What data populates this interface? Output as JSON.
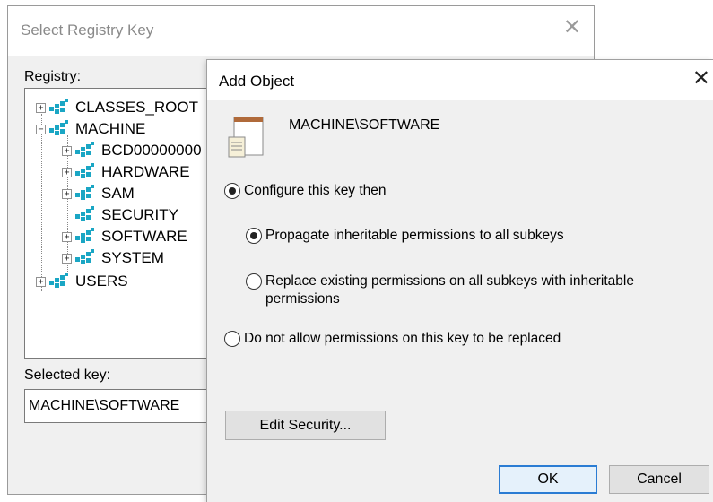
{
  "background_dialog": {
    "title": "Select Registry Key",
    "close_glyph": "✕",
    "registry_label": "Registry:",
    "tree": [
      {
        "label": "CLASSES_ROOT",
        "expander": "+"
      },
      {
        "label": "MACHINE",
        "expander": "−"
      },
      {
        "label": "BCD00000000",
        "expander": "+"
      },
      {
        "label": "HARDWARE",
        "expander": "+"
      },
      {
        "label": "SAM",
        "expander": "+"
      },
      {
        "label": "SECURITY",
        "expander": ""
      },
      {
        "label": "SOFTWARE",
        "expander": "+"
      },
      {
        "label": "SYSTEM",
        "expander": "+"
      },
      {
        "label": "USERS",
        "expander": "+"
      }
    ],
    "selected_key_label": "Selected key:",
    "selected_key_value": "MACHINE\\SOFTWARE"
  },
  "add_object_dialog": {
    "title": "Add Object",
    "close_glyph": "✕",
    "object_path": "MACHINE\\SOFTWARE",
    "options": {
      "configure": {
        "label": "Configure this key then",
        "checked": true
      },
      "propagate": {
        "label": "Propagate inheritable permissions to all subkeys",
        "checked": true
      },
      "replace": {
        "label_line1": "Replace existing permissions on all subkeys with inheritable",
        "label_line2": "permissions",
        "checked": false
      },
      "do_not_allow": {
        "label": "Do not allow permissions on this key to be replaced",
        "checked": false
      }
    },
    "edit_security_label": "Edit Security...",
    "ok_label": "OK",
    "cancel_label": "Cancel"
  },
  "colors": {
    "registry_icon": "#1aa6c4",
    "default_button_border": "#2b7cd3"
  }
}
